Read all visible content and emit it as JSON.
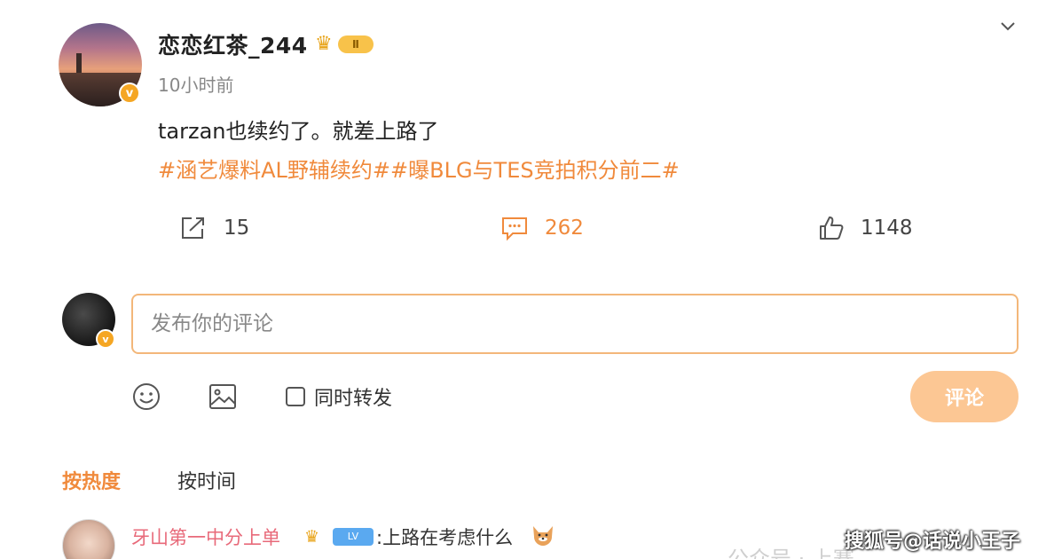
{
  "post": {
    "username": "恋恋红茶_244",
    "user_badge": "Ⅱ",
    "verified_mark": "v",
    "time": "10小时前",
    "text": "tarzan也续约了。就差上路了",
    "hashtags": "#涵艺爆料AL野辅续约##曝BLG与TES竞拍积分前二#",
    "share_count": "15",
    "comment_count": "262",
    "like_count": "1148"
  },
  "composer": {
    "placeholder": "发布你的评论",
    "repost_label": "同时转发",
    "submit_label": "评论",
    "verified_mark": "v"
  },
  "sort": {
    "hot": "按热度",
    "time": "按时间"
  },
  "first_comment": {
    "name": "牙山第一中分上单",
    "level_badge": "LV",
    "text": ":上路在考虑什么"
  },
  "watermark": "搜狐号@话说小王子",
  "faded_text": "公众号 · 上赛",
  "colors": {
    "accent": "#f08a3c",
    "verified": "#f5a623",
    "button_bg": "#fcc794",
    "input_border": "#f3b77a",
    "comment_name": "#e86a7a"
  },
  "icons": [
    "chevron-down-icon",
    "crown-icon",
    "share-icon",
    "comment-icon",
    "like-icon",
    "emoji-icon",
    "image-icon",
    "checkbox-icon",
    "dog-emoji-icon"
  ]
}
